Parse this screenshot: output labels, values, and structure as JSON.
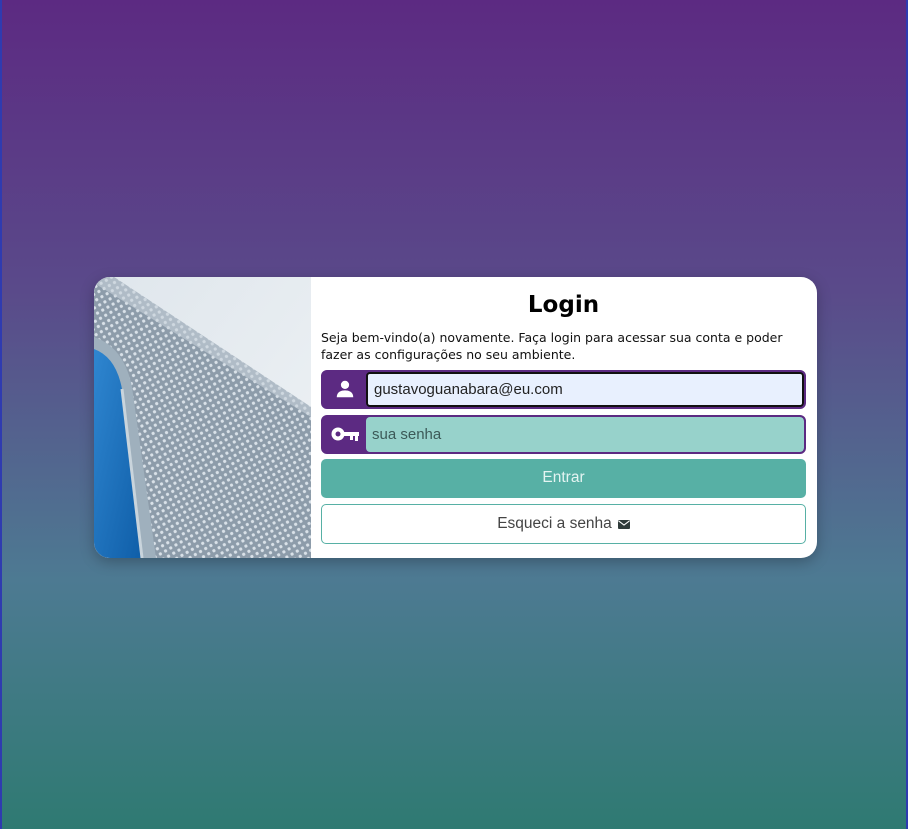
{
  "login": {
    "title": "Login",
    "subtitle": "Seja bem-vindo(a) novamente. Faça login para acessar sua conta e poder fazer as configurações no seu ambiente.",
    "email_value": "gustavoguanabara@eu.com",
    "password_placeholder": "sua senha",
    "submit_label": "Entrar",
    "forgot_label": "Esqueci a senha"
  },
  "icons": {
    "email_field": "user-icon",
    "password_field": "key-icon",
    "forgot_button": "mail-icon"
  },
  "colors": {
    "accent_purple": "#5c2a82",
    "accent_teal": "#57b0a5",
    "password_bg": "#97d2cb",
    "email_bg": "#e8f0fe"
  }
}
